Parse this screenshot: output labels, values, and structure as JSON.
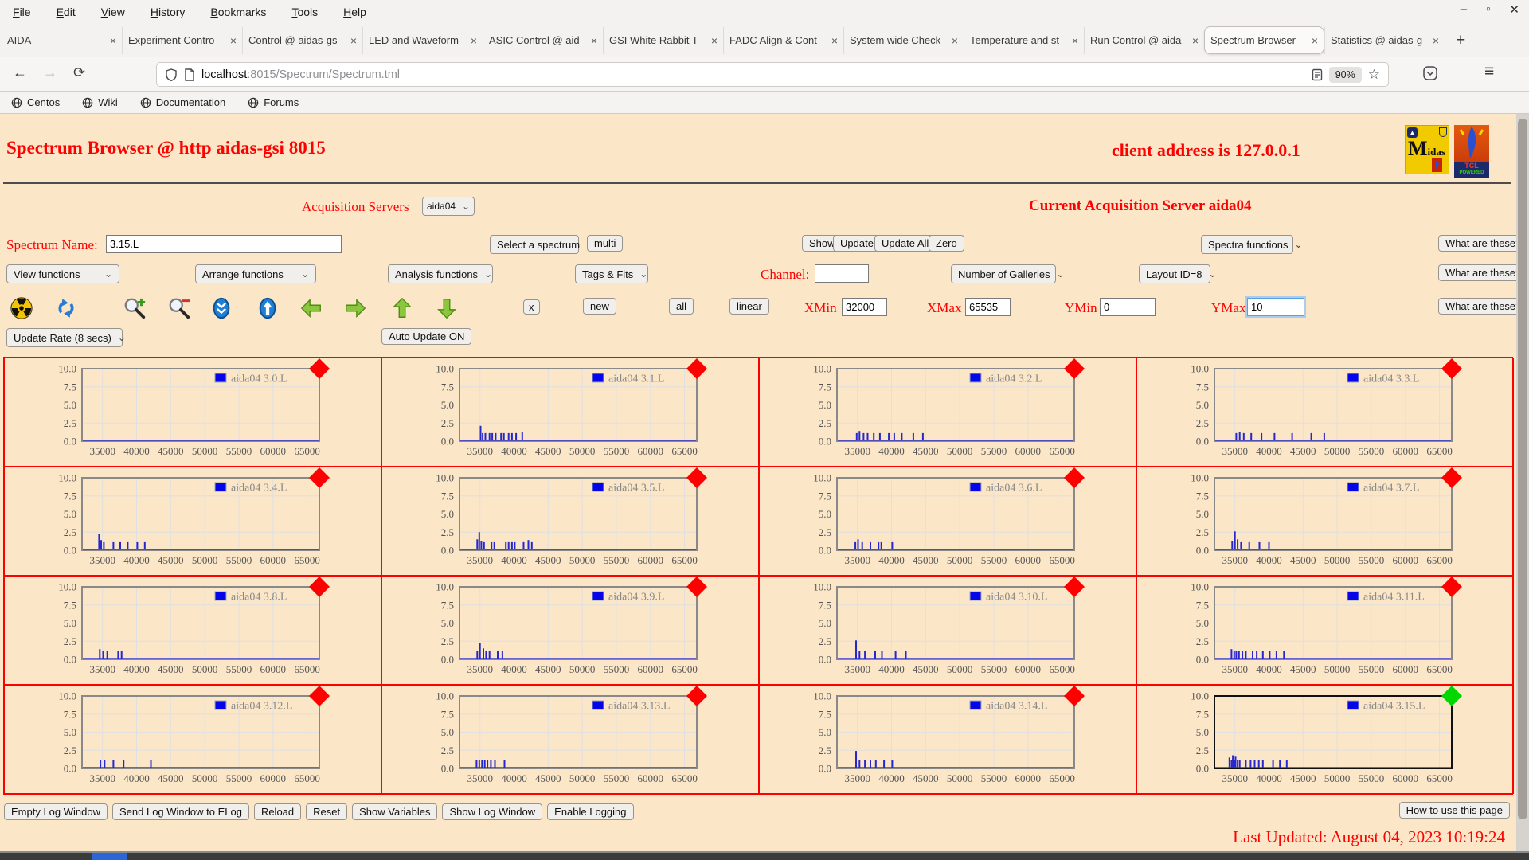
{
  "browser": {
    "menu": [
      "File",
      "Edit",
      "View",
      "History",
      "Bookmarks",
      "Tools",
      "Help"
    ],
    "tabs": [
      {
        "label": "AIDA",
        "active": false
      },
      {
        "label": "Experiment Contro",
        "active": false
      },
      {
        "label": "Control @ aidas-gs",
        "active": false
      },
      {
        "label": "LED and Waveform",
        "active": false
      },
      {
        "label": "ASIC Control @ aid",
        "active": false
      },
      {
        "label": "GSI White Rabbit T",
        "active": false
      },
      {
        "label": "FADC Align & Cont",
        "active": false
      },
      {
        "label": "System wide Check",
        "active": false
      },
      {
        "label": "Temperature and st",
        "active": false
      },
      {
        "label": "Run Control @ aida",
        "active": false
      },
      {
        "label": "Spectrum Browser",
        "active": true
      },
      {
        "label": "Statistics @ aidas-g",
        "active": false
      }
    ],
    "url": {
      "host": "localhost",
      "path": ":8015/Spectrum/Spectrum.tml"
    },
    "zoom_badge": "90%",
    "bookmarks": [
      "Centos",
      "Wiki",
      "Documentation",
      "Forums"
    ],
    "icons": {
      "close": "×",
      "new_tab": "+",
      "back": "←",
      "forward": "→",
      "reload": "⟳",
      "hamburger": "≡",
      "minimize": "–",
      "maximize": "▫",
      "window_close": "✕",
      "star": "☆",
      "chevron": "⌄"
    }
  },
  "page": {
    "title": "Spectrum Browser @ http aidas-gsi 8015",
    "client_address": "client address is 127.0.0.1",
    "acquisition_servers_label": "Acquisition Servers",
    "acquisition_server_value": "aida04",
    "current_server_text": "Current Acquisition Server aida04",
    "spectrum_name_label": "Spectrum Name:",
    "spectrum_name_value": "3.15.L",
    "select_spectrum": "Select a spectrum",
    "multi": "multi",
    "show": "Show",
    "update": "Update",
    "update_all": "Update All",
    "zero": "Zero",
    "spectra_functions": "Spectra functions",
    "what_are_these": "What are these?",
    "view_functions": "View functions",
    "arrange_functions": "Arrange functions",
    "analysis_functions": "Analysis functions",
    "tags_fits": "Tags & Fits",
    "channel_label": "Channel:",
    "channel_value": "",
    "number_of_galleries": "Number of Galleries",
    "layout_id": "Layout ID=8",
    "x_button": "x",
    "new_button": "new",
    "all_button": "all",
    "linear_button": "linear",
    "xmin_label": "XMin",
    "xmin": "32000",
    "xmax_label": "XMax",
    "xmax": "65535",
    "ymin_label": "YMin",
    "ymin": "0",
    "ymax_label": "YMax",
    "ymax": "10",
    "update_rate": "Update Rate (8 secs)",
    "auto_update": "Auto Update ON",
    "footer_buttons": [
      "Empty Log Window",
      "Send Log Window to ELog",
      "Reload",
      "Reset",
      "Show Variables",
      "Show Log Window",
      "Enable Logging"
    ],
    "how_to": "How to use this page",
    "last_updated": "Last Updated: August 04, 2023 10:19:24",
    "logos": {
      "midas_text": "Midas",
      "tcl_text": "TCL",
      "tcl_powered": "POWERED"
    }
  },
  "colors": {
    "page_bg": "#fbe6c7",
    "accent_red": "#ff0000",
    "grid_border": "#ff0000",
    "spike_blue": "#2727cf",
    "legend_blue": "#0505e8",
    "marker_red": "#ff0000",
    "marker_green": "#00d800"
  },
  "chart_data": {
    "type": "bar",
    "x_range": [
      32000,
      66800
    ],
    "x_ticks": [
      35000,
      40000,
      45000,
      50000,
      55000,
      60000,
      65000
    ],
    "y_ticks": [
      0,
      2.5,
      5,
      7.5,
      10
    ],
    "ylim": [
      0,
      10
    ],
    "legend_prefix": "aida04",
    "charts": [
      {
        "name": "aida04 3.0.L",
        "marker": "#ff0000",
        "selected": false,
        "spikes": []
      },
      {
        "name": "aida04 3.1.L",
        "marker": "#ff0000",
        "selected": false,
        "spikes": [
          [
            35100,
            2.0
          ],
          [
            35400,
            1
          ],
          [
            35800,
            1
          ],
          [
            36400,
            1
          ],
          [
            36800,
            1
          ],
          [
            37300,
            1
          ],
          [
            38100,
            1
          ],
          [
            38500,
            1
          ],
          [
            39200,
            1
          ],
          [
            39700,
            1
          ],
          [
            40300,
            1
          ],
          [
            41200,
            1.2
          ]
        ]
      },
      {
        "name": "aida04 3.2.L",
        "marker": "#ff0000",
        "selected": false,
        "spikes": [
          [
            34900,
            1
          ],
          [
            35300,
            1.3
          ],
          [
            35900,
            1
          ],
          [
            36500,
            1
          ],
          [
            37400,
            1
          ],
          [
            38300,
            1
          ],
          [
            39600,
            1
          ],
          [
            40400,
            1
          ],
          [
            41500,
            1
          ],
          [
            43200,
            1
          ],
          [
            44600,
            1
          ]
        ]
      },
      {
        "name": "aida04 3.3.L",
        "marker": "#ff0000",
        "selected": false,
        "spikes": [
          [
            35200,
            1
          ],
          [
            35700,
            1.2
          ],
          [
            36300,
            1
          ],
          [
            37400,
            1
          ],
          [
            38900,
            1
          ],
          [
            40800,
            1
          ],
          [
            43400,
            1
          ],
          [
            46200,
            1
          ],
          [
            48100,
            1
          ]
        ]
      },
      {
        "name": "aida04 3.4.L",
        "marker": "#ff0000",
        "selected": false,
        "spikes": [
          [
            34500,
            2.2
          ],
          [
            34800,
            1.3
          ],
          [
            35200,
            1
          ],
          [
            36600,
            1
          ],
          [
            37600,
            1
          ],
          [
            38700,
            1
          ],
          [
            40100,
            1
          ],
          [
            41200,
            1
          ]
        ]
      },
      {
        "name": "aida04 3.5.L",
        "marker": "#ff0000",
        "selected": false,
        "spikes": [
          [
            34600,
            1.4
          ],
          [
            34900,
            2.4
          ],
          [
            35200,
            1.2
          ],
          [
            35600,
            1
          ],
          [
            36700,
            1
          ],
          [
            37100,
            1
          ],
          [
            38800,
            1
          ],
          [
            39200,
            1
          ],
          [
            39700,
            1
          ],
          [
            40100,
            1
          ],
          [
            41400,
            1
          ],
          [
            42100,
            1.3
          ],
          [
            42600,
            1
          ]
        ]
      },
      {
        "name": "aida04 3.6.L",
        "marker": "#ff0000",
        "selected": false,
        "spikes": [
          [
            34700,
            1
          ],
          [
            35100,
            1.4
          ],
          [
            35700,
            1
          ],
          [
            36900,
            1
          ],
          [
            38100,
            1
          ],
          [
            38500,
            1
          ],
          [
            40100,
            1
          ]
        ]
      },
      {
        "name": "aida04 3.7.L",
        "marker": "#ff0000",
        "selected": false,
        "spikes": [
          [
            34600,
            1.2
          ],
          [
            35000,
            2.5
          ],
          [
            35400,
            1.4
          ],
          [
            35900,
            1
          ],
          [
            37100,
            1
          ],
          [
            38600,
            1
          ],
          [
            40000,
            1
          ]
        ]
      },
      {
        "name": "aida04 3.8.L",
        "marker": "#ff0000",
        "selected": false,
        "spikes": [
          [
            34600,
            1.3
          ],
          [
            35100,
            1
          ],
          [
            35700,
            1
          ],
          [
            37300,
            1
          ],
          [
            37800,
            1
          ]
        ]
      },
      {
        "name": "aida04 3.9.L",
        "marker": "#ff0000",
        "selected": false,
        "spikes": [
          [
            34600,
            1
          ],
          [
            35000,
            2.1
          ],
          [
            35500,
            1.4
          ],
          [
            35900,
            1
          ],
          [
            36400,
            1
          ],
          [
            37600,
            1
          ],
          [
            38300,
            1
          ]
        ]
      },
      {
        "name": "aida04 3.10.L",
        "marker": "#ff0000",
        "selected": false,
        "spikes": [
          [
            34800,
            2.5
          ],
          [
            35300,
            1
          ],
          [
            36100,
            1
          ],
          [
            37600,
            1
          ],
          [
            38600,
            1
          ],
          [
            40600,
            1
          ],
          [
            42100,
            1
          ]
        ]
      },
      {
        "name": "aida04 3.11.L",
        "marker": "#ff0000",
        "selected": false,
        "spikes": [
          [
            34500,
            1.3
          ],
          [
            34900,
            1
          ],
          [
            35200,
            1
          ],
          [
            35600,
            1
          ],
          [
            36100,
            1
          ],
          [
            36600,
            1
          ],
          [
            37600,
            1
          ],
          [
            38200,
            1
          ],
          [
            39100,
            1
          ],
          [
            40100,
            1
          ],
          [
            41100,
            1
          ],
          [
            42200,
            1
          ]
        ]
      },
      {
        "name": "aida04 3.12.L",
        "marker": "#ff0000",
        "selected": false,
        "spikes": [
          [
            34700,
            1
          ],
          [
            35300,
            1
          ],
          [
            36600,
            1
          ],
          [
            38100,
            1
          ],
          [
            42100,
            1
          ]
        ]
      },
      {
        "name": "aida04 3.13.L",
        "marker": "#ff0000",
        "selected": false,
        "spikes": [
          [
            34500,
            1
          ],
          [
            34900,
            1
          ],
          [
            35300,
            1
          ],
          [
            35700,
            1
          ],
          [
            36100,
            1
          ],
          [
            36600,
            1
          ],
          [
            37200,
            1
          ],
          [
            38600,
            1
          ]
        ]
      },
      {
        "name": "aida04 3.14.L",
        "marker": "#ff0000",
        "selected": false,
        "spikes": [
          [
            34800,
            2.3
          ],
          [
            35300,
            1
          ],
          [
            36100,
            1
          ],
          [
            36900,
            1
          ],
          [
            37700,
            1
          ],
          [
            38900,
            1
          ],
          [
            40100,
            1
          ]
        ]
      },
      {
        "name": "aida04 3.15.L",
        "marker": "#00d800",
        "selected": true,
        "spikes": [
          [
            34200,
            1.4
          ],
          [
            34500,
            1
          ],
          [
            34700,
            1.7
          ],
          [
            34900,
            1
          ],
          [
            35100,
            1.5
          ],
          [
            35400,
            1
          ],
          [
            35700,
            1
          ],
          [
            36600,
            1
          ],
          [
            37300,
            1
          ],
          [
            37900,
            1
          ],
          [
            38500,
            1
          ],
          [
            39100,
            1
          ],
          [
            40600,
            1
          ],
          [
            41600,
            1
          ],
          [
            42600,
            1
          ]
        ]
      }
    ]
  }
}
